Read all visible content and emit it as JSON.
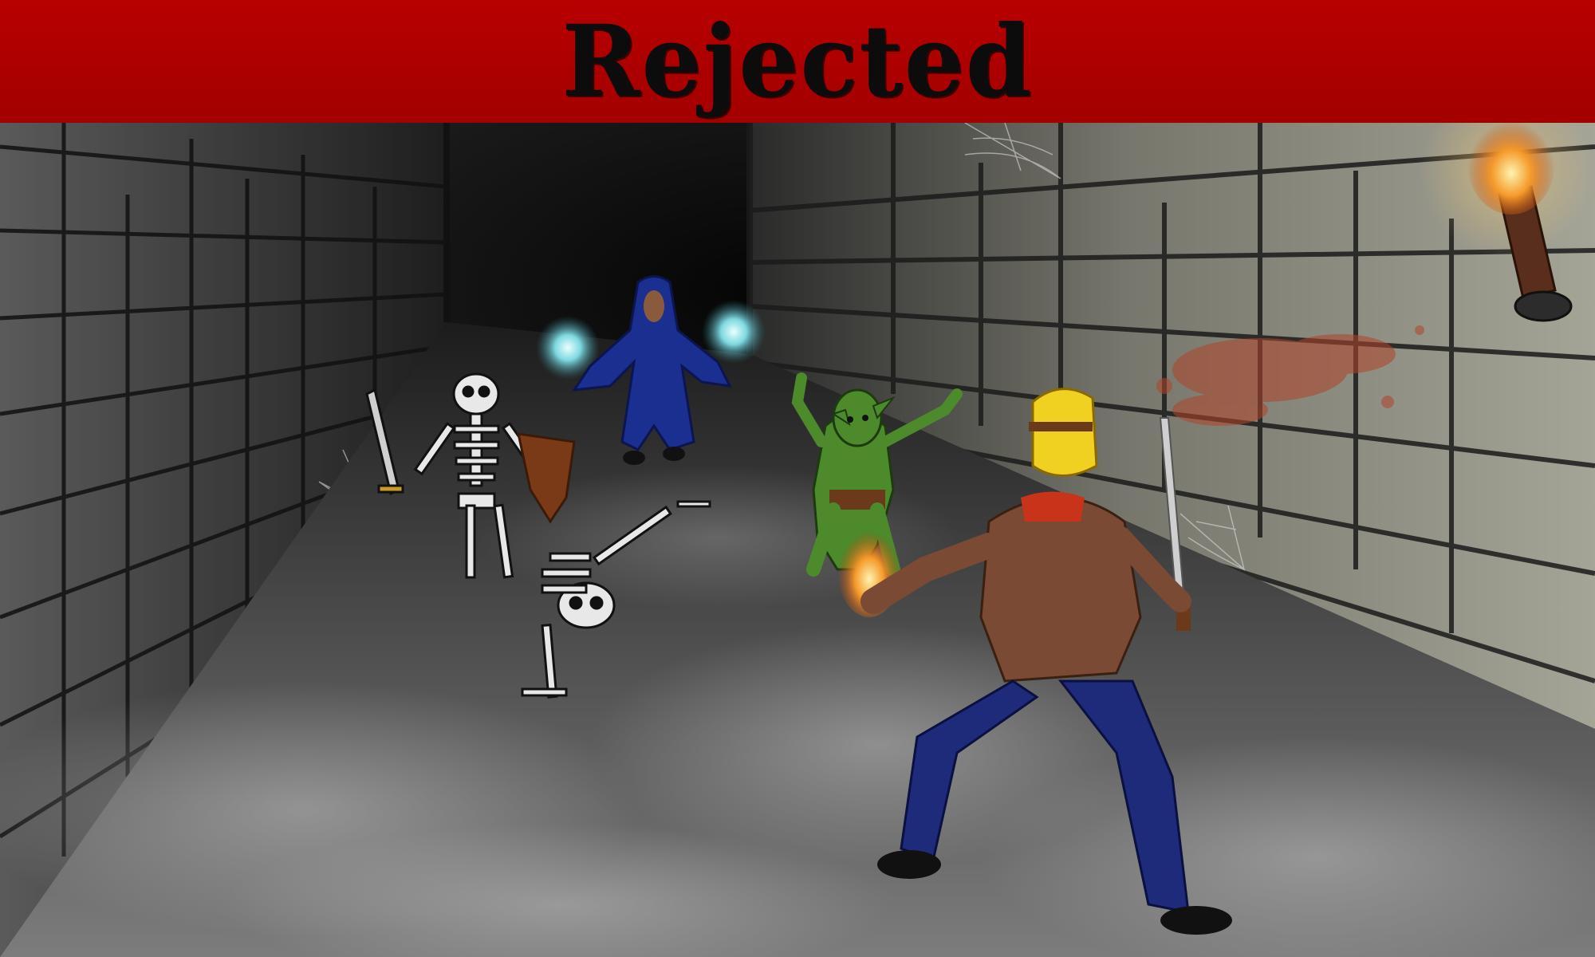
{
  "screen": {
    "title": "Rejected"
  },
  "palette": {
    "banner": "#b30000",
    "title_text": "#0c0c0c",
    "corridor_dark": "#0b0b0b",
    "wall_left": "#3a3a3a",
    "wall_right": "#8e8e83",
    "fog": "#9a9a9a",
    "mage_robe": "#1a2f8f",
    "goblin_skin": "#4c8a2c",
    "hero_jacket": "#7a4a35",
    "hero_pants": "#1e2a7a",
    "hero_hair": "#f0d020",
    "hero_scarf": "#c8341a",
    "torch_flame": "#f4b030",
    "blood": "#b0452a"
  },
  "scene": {
    "characters": [
      "hooded-mage",
      "skeleton-with-sword",
      "crawling-skeleton",
      "goblin",
      "hero"
    ],
    "props": [
      "wall-torch",
      "cobwebs",
      "blood-splatter",
      "fog"
    ]
  }
}
